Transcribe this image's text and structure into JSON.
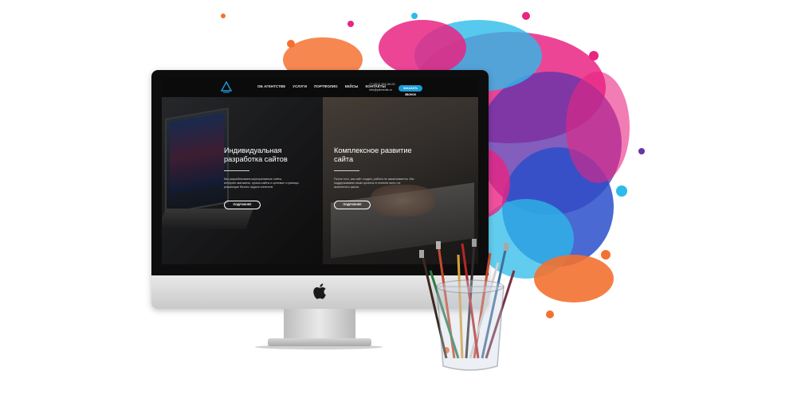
{
  "site": {
    "nav": {
      "links": [
        "ОБ АГЕНТСТВЕ",
        "УСЛУГИ",
        "ПОРТФОЛИО",
        "КЕЙСЫ",
        "КОНТАКТЫ"
      ],
      "phone": "+7 (812) 384-99-00",
      "email": "info@pdmedia.ru",
      "cta": "ЗАКАЗАТЬ ЗВОНОК"
    },
    "panels": [
      {
        "title_line1": "Индивидуальная",
        "title_line2": "разработка сайтов",
        "text_line1": "Мы разрабатываем корпоративные сайты,",
        "text_line2": "интернет-магазины, промо-сайты и целевые страницы",
        "text_line3": "решающие бизнес задачи клиентов",
        "button": "ПОДРОБНЕЕ"
      },
      {
        "title_line1": "Комплексное развитие",
        "title_line2": "сайта",
        "text_line1": "После того, как сайт создан, работа не заканчивается. Мы",
        "text_line2": "поддерживаем наши проекты в течение всего их",
        "text_line3": "жизненного цикла.",
        "button": "ПОДРОБНЕЕ"
      }
    ]
  },
  "colors": {
    "accent": "#1e9bd7",
    "splash_magenta": "#e8197c",
    "splash_blue": "#1f45c8",
    "splash_cyan": "#22b8e8",
    "splash_orange": "#f36a26",
    "splash_purple": "#5b2aa6"
  }
}
